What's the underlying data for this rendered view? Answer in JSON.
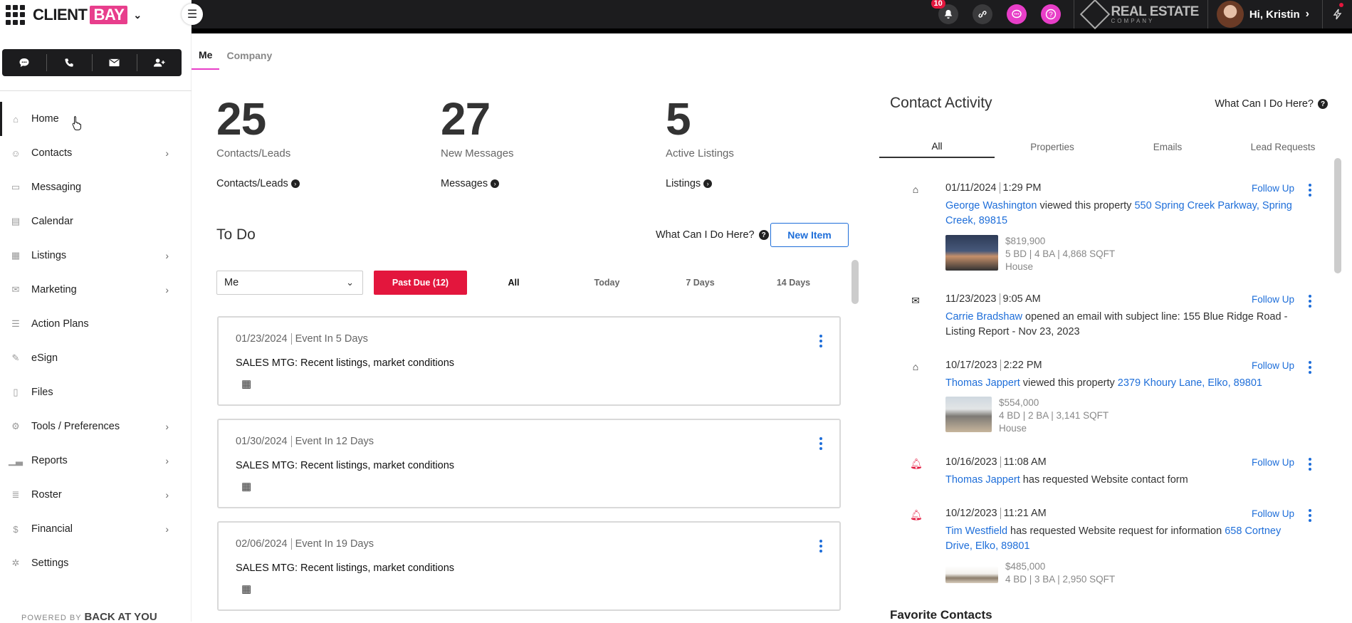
{
  "brand": {
    "name_a": "CLIENT",
    "name_b": "BAY"
  },
  "topbar": {
    "notifications_count": "10",
    "re_logo_line1": "REAL ESTATE",
    "re_logo_line2": "COMPANY",
    "greeting": "Hi, Kristin"
  },
  "quick_actions": [
    "chat-icon",
    "phone-icon",
    "mail-icon",
    "add-user-icon"
  ],
  "nav": {
    "items": [
      {
        "label": "Home",
        "icon": "home-icon",
        "submenu": false
      },
      {
        "label": "Contacts",
        "icon": "contacts-icon",
        "submenu": true
      },
      {
        "label": "Messaging",
        "icon": "message-icon",
        "submenu": false
      },
      {
        "label": "Calendar",
        "icon": "calendar-icon",
        "submenu": false
      },
      {
        "label": "Listings",
        "icon": "listings-icon",
        "submenu": true
      },
      {
        "label": "Marketing",
        "icon": "marketing-icon",
        "submenu": true
      },
      {
        "label": "Action Plans",
        "icon": "action-plans-icon",
        "submenu": false
      },
      {
        "label": "eSign",
        "icon": "esign-icon",
        "submenu": false
      },
      {
        "label": "Files",
        "icon": "files-icon",
        "submenu": false
      },
      {
        "label": "Tools / Preferences",
        "icon": "tools-icon",
        "submenu": true
      },
      {
        "label": "Reports",
        "icon": "reports-icon",
        "submenu": true
      },
      {
        "label": "Roster",
        "icon": "roster-icon",
        "submenu": true
      },
      {
        "label": "Financial",
        "icon": "financial-icon",
        "submenu": true
      },
      {
        "label": "Settings",
        "icon": "settings-icon",
        "submenu": false
      }
    ],
    "powered_by": "POWERED BY",
    "powered_brand": "BACK AT YOU"
  },
  "scope_tabs": {
    "me": "Me",
    "company": "Company"
  },
  "stats": [
    {
      "num": "25",
      "label": "Contacts/Leads",
      "link": "Contacts/Leads"
    },
    {
      "num": "27",
      "label": "New Messages",
      "link": "Messages"
    },
    {
      "num": "5",
      "label": "Active Listings",
      "link": "Listings"
    }
  ],
  "todo": {
    "title": "To Do",
    "help": "What Can I Do Here?",
    "new_item": "New Item",
    "assignee": "Me",
    "filters": [
      "Past Due (12)",
      "All",
      "Today",
      "7 Days",
      "14 Days"
    ],
    "items": [
      {
        "date": "01/23/2024",
        "when": "Event In 5 Days",
        "subject": "SALES MTG: Recent listings, market conditions"
      },
      {
        "date": "01/30/2024",
        "when": "Event In 12 Days",
        "subject": "SALES MTG: Recent listings, market conditions"
      },
      {
        "date": "02/06/2024",
        "when": "Event In 19 Days",
        "subject": "SALES MTG: Recent listings, market conditions"
      }
    ]
  },
  "activity": {
    "title": "Contact Activity",
    "help": "What Can I Do Here?",
    "tabs": [
      "All",
      "Properties",
      "Emails",
      "Lead Requests"
    ],
    "follow_up": "Follow Up",
    "items": [
      {
        "icon": "home-icon",
        "date": "01/11/2024",
        "time": "1:29 PM",
        "who": "George Washington",
        "action": " viewed this property ",
        "target": "550 Spring Creek Parkway, Spring Creek, 89815",
        "price": "$819,900",
        "specs": "5 BD | 4 BA | 4,868 SQFT",
        "ptype": "House"
      },
      {
        "icon": "mail-icon",
        "date": "11/23/2023",
        "time": "9:05 AM",
        "who": "Carrie Bradshaw",
        "action": " opened an email with subject line: 155 Blue Ridge Road - Listing Report - Nov 23, 2023",
        "target": ""
      },
      {
        "icon": "home-icon",
        "date": "10/17/2023",
        "time": "2:22 PM",
        "who": "Thomas Jappert",
        "action": " viewed this property ",
        "target": "2379 Khoury Lane, Elko, 89801",
        "price": "$554,000",
        "specs": "4 BD | 2 BA | 3,141 SQFT",
        "ptype": "House"
      },
      {
        "icon": "bell-icon",
        "date": "10/16/2023",
        "time": "11:08 AM",
        "who": "Thomas Jappert",
        "action": " has requested Website contact form",
        "target": ""
      },
      {
        "icon": "bell-icon",
        "date": "10/12/2023",
        "time": "11:21 AM",
        "who": "Tim Westfield",
        "action": " has requested Website request for information ",
        "target": "658 Cortney Drive, Elko, 89801",
        "price": "$485,000",
        "specs": "4 BD | 3 BA | 2,950 SQFT"
      }
    ]
  },
  "favorites_title": "Favorite Contacts",
  "colors": {
    "brand_pink": "#e83e8c",
    "accent_blue": "#1e6ed9",
    "alert_red": "#e3163d",
    "topbar": "#1c1c1e"
  }
}
